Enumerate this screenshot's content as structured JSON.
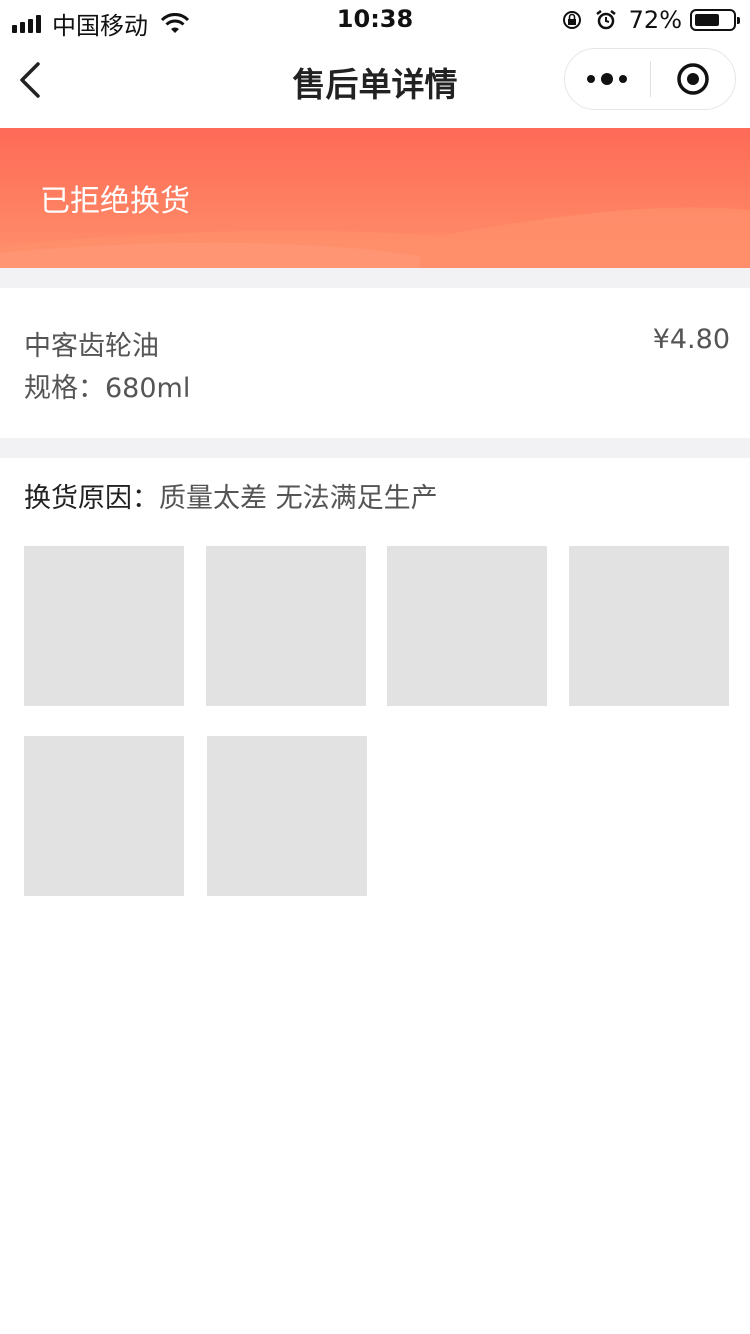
{
  "status_bar": {
    "carrier": "中国移动",
    "time": "10:38",
    "battery_percent": "72%",
    "battery_level": 0.72
  },
  "nav": {
    "title": "售后单详情"
  },
  "banner": {
    "status": "已拒绝换货",
    "colors": [
      "#fe6a57",
      "#fe9270"
    ]
  },
  "product": {
    "name": "中客齿轮油",
    "spec": "规格：680ml",
    "price": "¥4.80"
  },
  "reason": {
    "label": "换货原因：",
    "text": "质量太差 无法满足生产"
  },
  "images": {
    "count": 6,
    "placeholder_color": "#e2e2e2"
  }
}
